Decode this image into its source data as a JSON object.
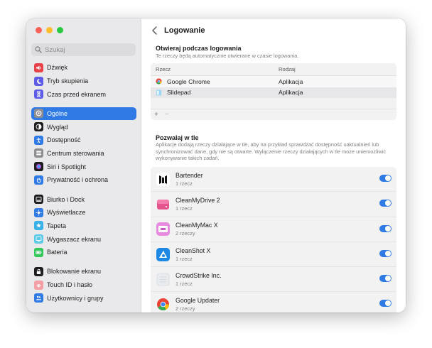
{
  "sidebar": {
    "search_placeholder": "Szukaj",
    "groups": [
      [
        {
          "label": "Dźwięk",
          "icon": "speaker-icon",
          "color": "#e8424b"
        },
        {
          "label": "Tryb skupienia",
          "icon": "moon-icon",
          "color": "#5e5ce6"
        },
        {
          "label": "Czas przed ekranem",
          "icon": "hourglass-icon",
          "color": "#5e5ce6"
        }
      ],
      [
        {
          "label": "Ogólne",
          "icon": "gear-icon",
          "color": "#8e8e93",
          "selected": true
        },
        {
          "label": "Wygląd",
          "icon": "appearance-icon",
          "color": "#1d1d1f"
        },
        {
          "label": "Dostępność",
          "icon": "accessibility-icon",
          "color": "#2f7ae5"
        },
        {
          "label": "Centrum sterowania",
          "icon": "control-center-icon",
          "color": "#8e8e93"
        },
        {
          "label": "Siri i Spotlight",
          "icon": "siri-icon",
          "color": "#1d1d1f"
        },
        {
          "label": "Prywatność i ochrona",
          "icon": "hand-icon",
          "color": "#2f7ae5"
        }
      ],
      [
        {
          "label": "Biurko i Dock",
          "icon": "dock-icon",
          "color": "#1d1d1f"
        },
        {
          "label": "Wyświetlacze",
          "icon": "sun-icon",
          "color": "#2f7ae5"
        },
        {
          "label": "Tapeta",
          "icon": "wallpaper-icon",
          "color": "#3ab0e8"
        },
        {
          "label": "Wygaszacz ekranu",
          "icon": "screensaver-icon",
          "color": "#5ac8e8"
        },
        {
          "label": "Bateria",
          "icon": "battery-icon",
          "color": "#34c759"
        }
      ],
      [
        {
          "label": "Blokowanie ekranu",
          "icon": "lock-icon",
          "color": "#1d1d1f"
        },
        {
          "label": "Touch ID i hasło",
          "icon": "fingerprint-icon",
          "color": "#f2a0a5"
        },
        {
          "label": "Użytkownicy i grupy",
          "icon": "users-icon",
          "color": "#2f7ae5"
        }
      ]
    ]
  },
  "main": {
    "title": "Logowanie",
    "open_at_login": {
      "title": "Otwieraj podczas logowania",
      "description": "Te rzeczy będą automatycznie otwierane w czasie logowania.",
      "columns": [
        "Rzecz",
        "Rodzaj"
      ],
      "rows": [
        {
          "name": "Google Chrome",
          "kind": "Aplikacja",
          "icon": "chrome-icon"
        },
        {
          "name": "Slidepad",
          "kind": "Aplikacja",
          "icon": "slidepad-icon"
        }
      ],
      "add_label": "+",
      "remove_label": "−"
    },
    "background": {
      "title": "Pozwalaj w tle",
      "description": "Aplikacje dodają rzeczy działające w tle, aby na przykład sprawdzać dostępność uaktualnień lub synchronizować dane, gdy nie są otwarte. Wyłączenie rzeczy działających w tle może uniemożliwić wykonywanie takich zadań.",
      "items": [
        {
          "name": "Bartender",
          "sub": "1 rzecz",
          "icon": "bartender-icon",
          "enabled": true
        },
        {
          "name": "CleanMyDrive 2",
          "sub": "1 rzecz",
          "icon": "cleanmydrive-icon",
          "enabled": true
        },
        {
          "name": "CleanMyMac X",
          "sub": "2 rzeczy",
          "icon": "cleanmymac-icon",
          "enabled": true
        },
        {
          "name": "CleanShot X",
          "sub": "1 rzecz",
          "icon": "cleanshot-icon",
          "enabled": true
        },
        {
          "name": "CrowdStrike Inc.",
          "sub": "1 rzecz",
          "icon": "crowdstrike-icon",
          "enabled": true
        },
        {
          "name": "Google Updater",
          "sub": "2 rzeczy",
          "icon": "google-updater-icon",
          "enabled": true
        }
      ]
    }
  }
}
